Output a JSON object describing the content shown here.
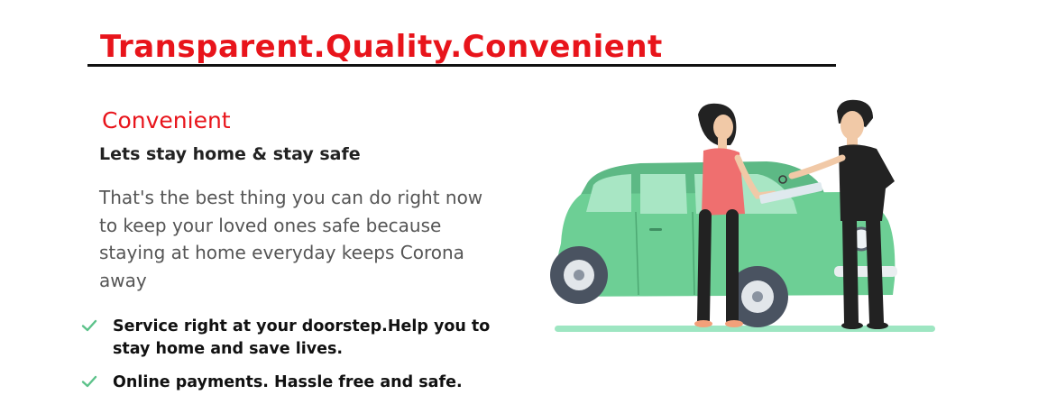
{
  "headline": {
    "text": "Transparent.Quality.Convenient"
  },
  "section": {
    "heading": "Convenient",
    "subheading": "Lets stay home & stay safe",
    "description": "That's the best thing you can do right now to keep your loved ones safe because staying at home everyday keeps Corona away"
  },
  "features": [
    {
      "text": "Service right at your doorstep.Help you to stay home and save lives."
    },
    {
      "text": "Online payments. Hassle free and safe."
    }
  ],
  "colors": {
    "accent_red": "#e8141b",
    "check_green": "#5cc28a",
    "car_green": "#6dcf95",
    "ground_mint": "#9ee6c2"
  },
  "icons": {
    "check": "check-icon"
  }
}
